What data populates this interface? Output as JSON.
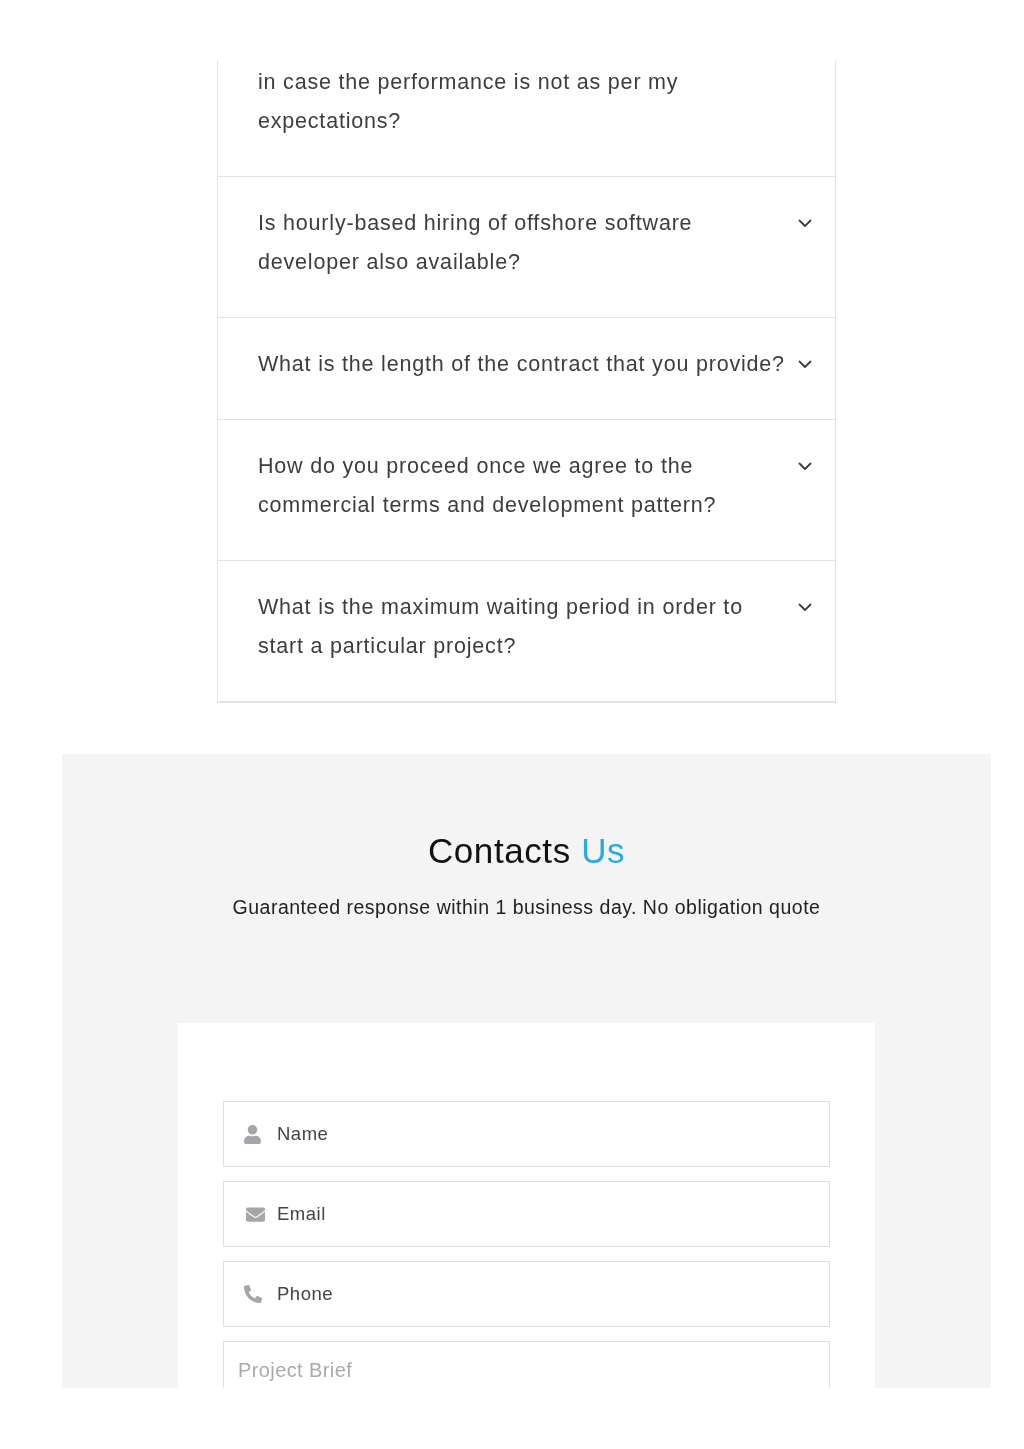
{
  "faq": {
    "partial_question": "in case the performance is not as per my expectations?",
    "items": [
      {
        "question": "Is hourly-based hiring of offshore software developer also available?",
        "expanded": false
      },
      {
        "question": "What is the length of the contract that you provide?",
        "expanded": false
      },
      {
        "question": "How do you proceed once we agree to the commercial terms and development pattern?",
        "expanded": false
      },
      {
        "question": "What is the maximum waiting period in order to start a particular project?",
        "expanded": false
      }
    ]
  },
  "contact": {
    "title": "Contacts",
    "title_highlight": "Us",
    "subtitle": "Guaranteed response within 1 business day. No obligation quote",
    "fields": [
      {
        "kind": "name",
        "placeholder": "Name"
      },
      {
        "kind": "email",
        "placeholder": "Email"
      },
      {
        "kind": "phone",
        "placeholder": "Phone"
      },
      {
        "kind": "brief",
        "placeholder": "Project Brief"
      }
    ]
  }
}
